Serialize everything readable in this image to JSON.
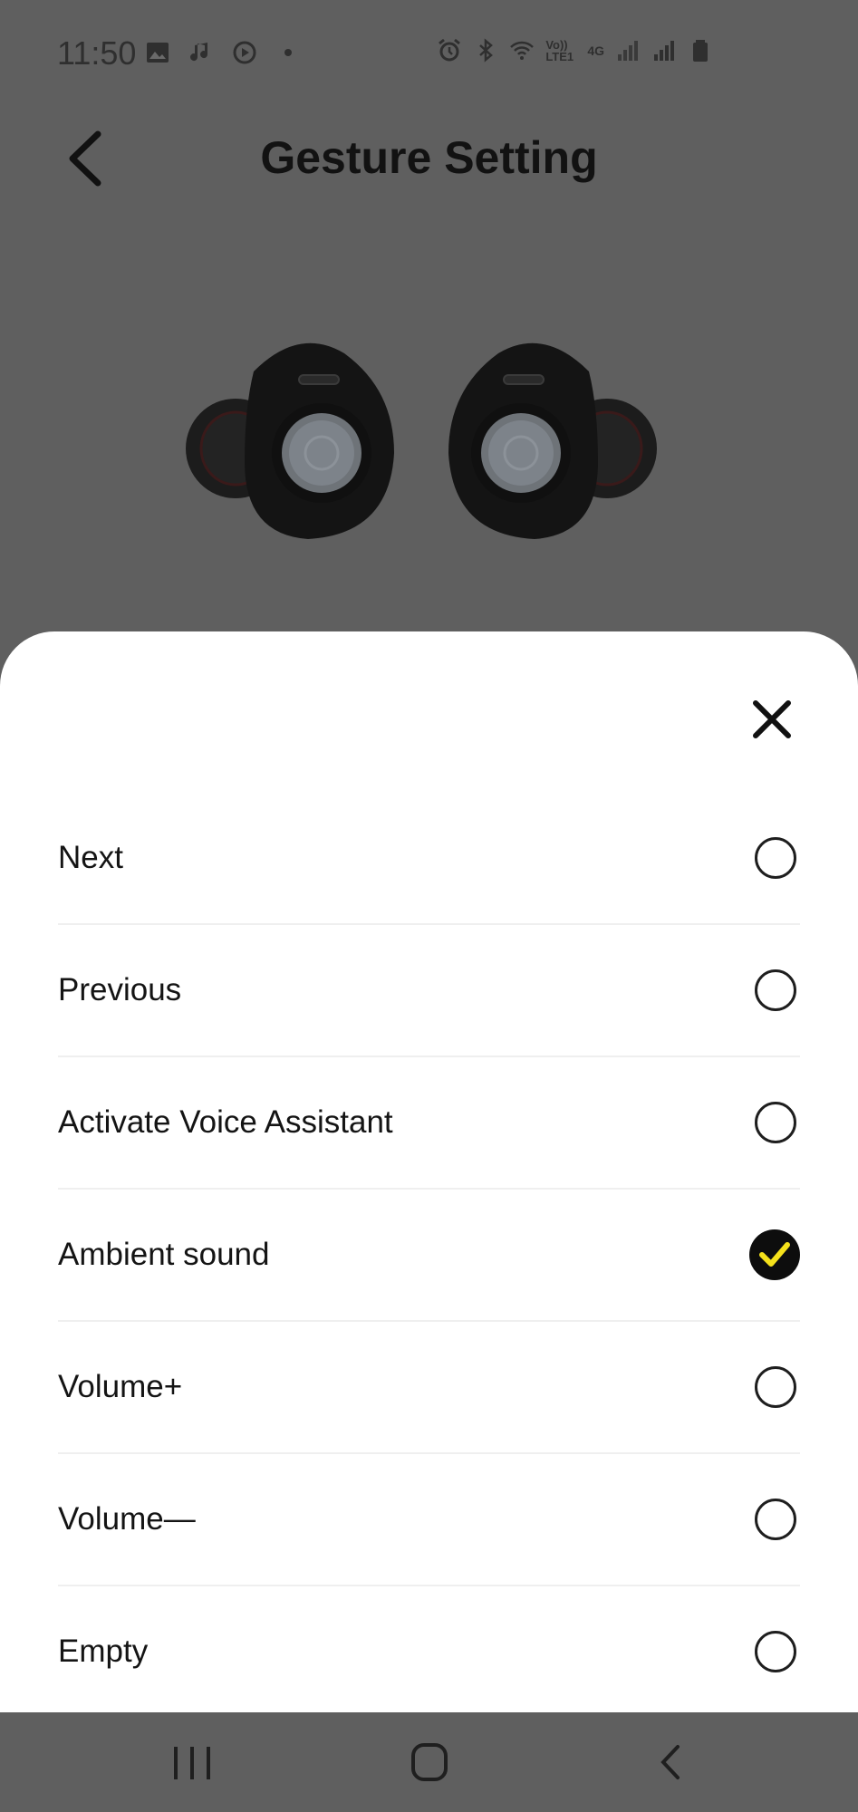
{
  "status_bar": {
    "time": "11:50",
    "left_icons": [
      "image-icon",
      "music-icon",
      "play-circle-icon",
      "dot-icon"
    ],
    "right_icons": [
      "alarm-icon",
      "bluetooth-icon",
      "wifi-icon",
      "volte-icon",
      "4g-icon",
      "signal-icon",
      "signal-icon",
      "battery-icon"
    ],
    "volte_label": "Vo)) LTE1",
    "network_label": "4G"
  },
  "header": {
    "title": "Gesture Setting",
    "back_icon": "chevron-left-icon"
  },
  "hero": {
    "image": "earbuds-image"
  },
  "sheet": {
    "close_icon": "close-icon",
    "options": [
      {
        "label": "Next",
        "selected": false
      },
      {
        "label": "Previous",
        "selected": false
      },
      {
        "label": "Activate Voice Assistant",
        "selected": false
      },
      {
        "label": "Ambient sound",
        "selected": true
      },
      {
        "label": "Volume+",
        "selected": false
      },
      {
        "label": "Volume—",
        "selected": false
      },
      {
        "label": "Empty",
        "selected": false
      }
    ],
    "check_color": "#f5e11b"
  },
  "nav_bar": {
    "recents_icon": "recents-icon",
    "home_icon": "home-icon",
    "back_icon": "back-icon"
  }
}
